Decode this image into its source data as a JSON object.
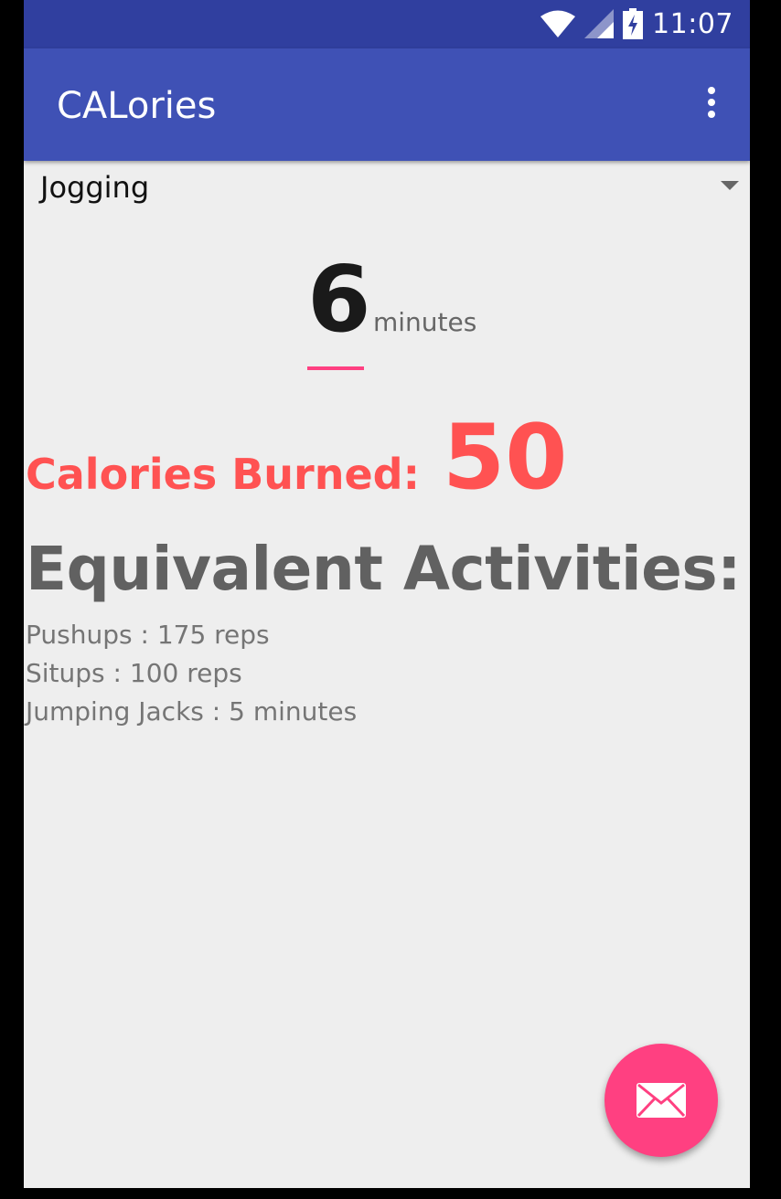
{
  "status_bar": {
    "time": "11:07",
    "icons": [
      "wifi-icon",
      "signal-icon",
      "battery-charging-icon"
    ]
  },
  "app_bar": {
    "title": "CALories",
    "overflow_icon": "more-vert-icon"
  },
  "activity_spinner": {
    "selected": "Jogging"
  },
  "duration": {
    "value": "6",
    "unit": "minutes"
  },
  "calories": {
    "label": "Calories Burned:",
    "value": "50"
  },
  "equivalents": {
    "title": "Equivalent Activities:",
    "items": [
      "Pushups : 175 reps",
      "Situps : 100 reps",
      "Jumping Jacks : 5 minutes"
    ]
  },
  "fab": {
    "icon": "email-icon"
  },
  "colors": {
    "status_bar": "#303f9f",
    "app_bar": "#3f51b5",
    "accent": "#ff4081",
    "calories": "#ff5252",
    "background": "#eeeeee"
  }
}
